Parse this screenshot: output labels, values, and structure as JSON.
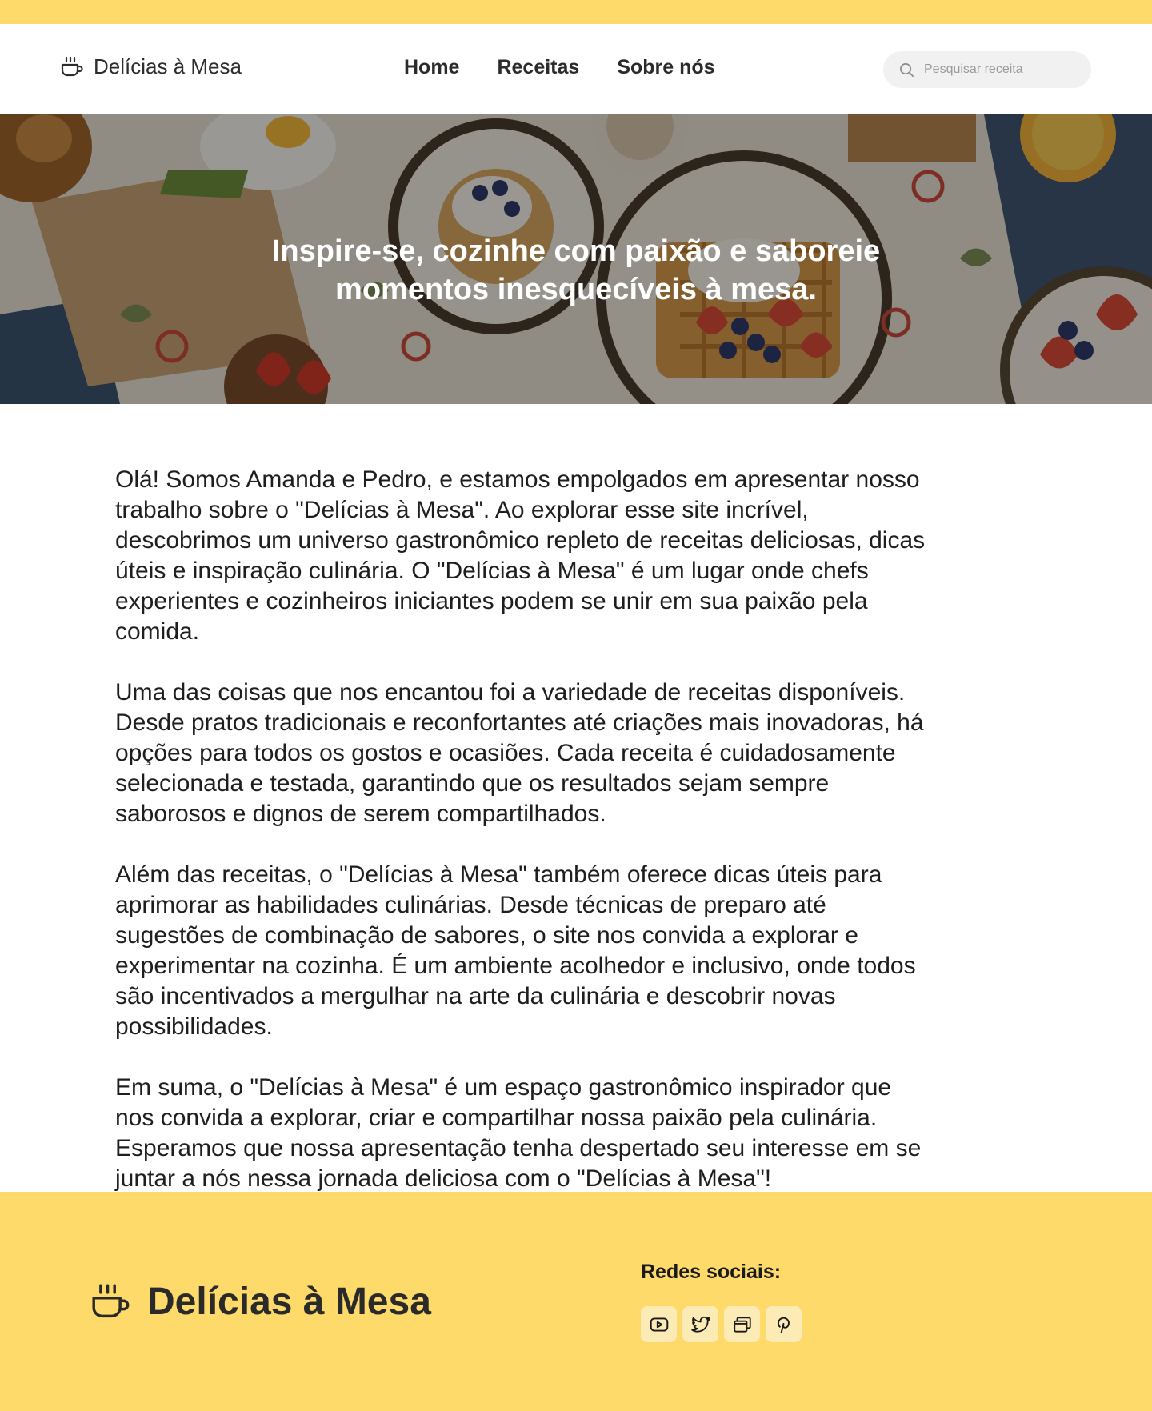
{
  "brand": {
    "name": "Delícias à Mesa",
    "icon": "coffee-cup-icon"
  },
  "nav": {
    "items": [
      "Home",
      "Receitas",
      "Sobre nós"
    ]
  },
  "search": {
    "placeholder": "Pesquisar receita",
    "icon": "search-icon"
  },
  "hero": {
    "line1": "Inspire-se, cozinhe com paixão e saboreie",
    "line2": "momentos inesquecíveis à mesa."
  },
  "content": {
    "paragraphs": [
      "Olá! Somos Amanda e Pedro, e estamos empolgados em apresentar nosso trabalho sobre o \"Delícias à Mesa\". Ao explorar esse site incrível, descobrimos um universo gastronômico repleto de receitas deliciosas, dicas úteis e inspiração culinária. O \"Delícias à Mesa\" é um lugar onde chefs experientes e cozinheiros iniciantes podem se unir em sua paixão pela comida.",
      "Uma das coisas que nos encantou foi a variedade de receitas disponíveis. Desde pratos tradicionais e reconfortantes até criações mais inovadoras, há opções para todos os gostos e ocasiões. Cada receita é cuidadosamente selecionada e testada, garantindo que os resultados sejam sempre saborosos e dignos de serem compartilhados.",
      "Além das receitas, o \"Delícias à Mesa\" também oferece dicas úteis para aprimorar as habilidades culinárias. Desde técnicas de preparo até sugestões de combinação de sabores, o site nos convida a explorar e experimentar na cozinha. É um ambiente acolhedor e inclusivo, onde todos são incentivados a mergulhar na arte da culinária e descobrir novas possibilidades.",
      "Em suma, o \"Delícias à Mesa\" é um espaço gastronômico inspirador que nos convida a explorar, criar e compartilhar nossa paixão pela culinária. Esperamos que nossa apresentação tenha despertado seu interesse em se juntar a nós nessa jornada deliciosa com o \"Delícias à Mesa\"!"
    ]
  },
  "footer": {
    "brand_name": "Delícias à Mesa",
    "social_title": "Redes sociais:",
    "socials": [
      "youtube-icon",
      "twitter-icon",
      "windows-icon",
      "pinterest-icon"
    ]
  },
  "colors": {
    "accent": "#FDDA6A",
    "social_bg": "#FCEBB4",
    "text": "#1e1e1e"
  }
}
